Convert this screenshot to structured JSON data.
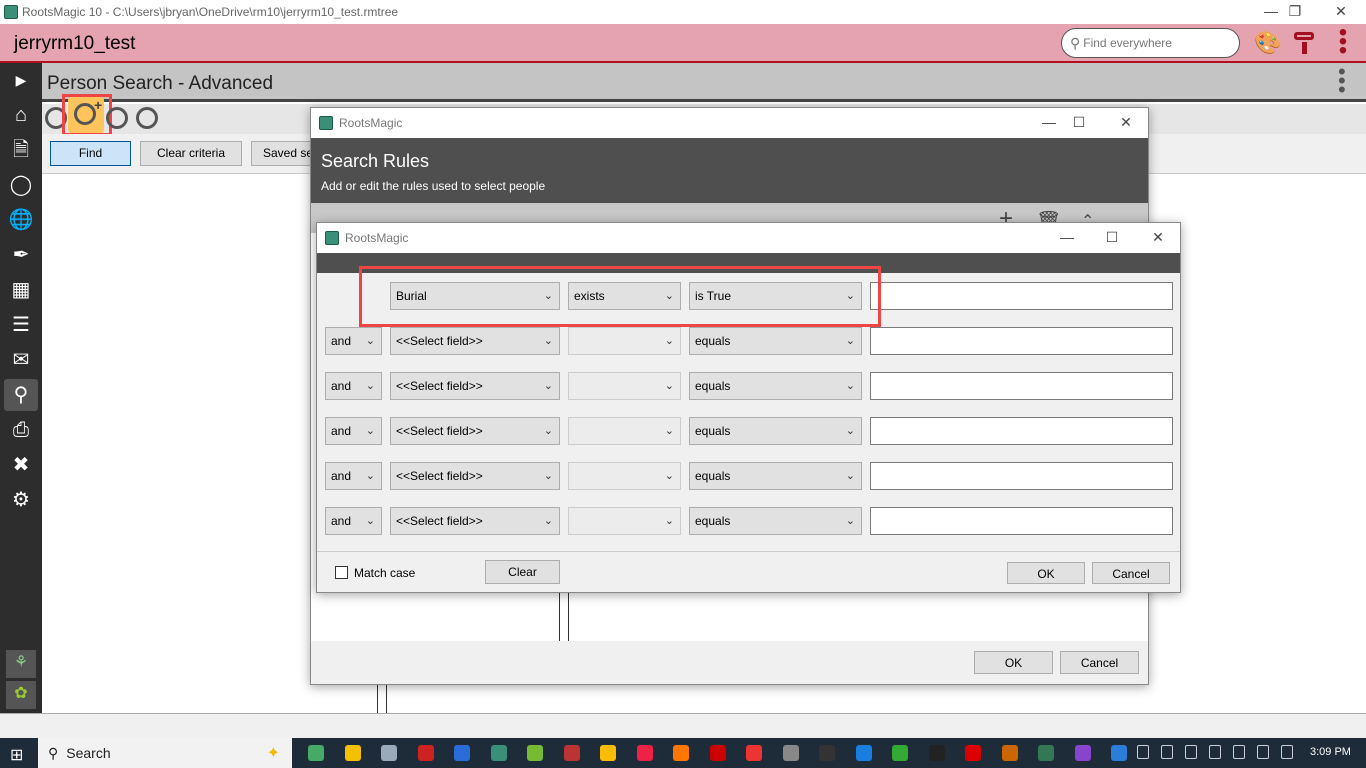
{
  "window": {
    "title": "RootsMagic 10 - C:\\Users\\jbryan\\OneDrive\\rm10\\jerryrm10_test.rmtree"
  },
  "header": {
    "database": "jerryrm10_test",
    "search_placeholder": "Find everywhere"
  },
  "page": {
    "title": "Person Search - Advanced",
    "buttons": {
      "find": "Find",
      "clear": "Clear criteria",
      "saved": "Saved se"
    }
  },
  "sidebar": {
    "items": [
      "expand",
      "home",
      "file",
      "people",
      "places",
      "sources",
      "media",
      "tasks",
      "mail",
      "search",
      "print",
      "tools",
      "settings"
    ]
  },
  "outer_dialog": {
    "app": "RootsMagic",
    "title": "Search Rules",
    "subtitle": "Add or edit the rules used to select people",
    "ok": "OK",
    "cancel": "Cancel"
  },
  "inner_dialog": {
    "app": "RootsMagic",
    "rows": [
      {
        "conj": "",
        "field": "Burial",
        "qualifier": "exists",
        "operator": "is True",
        "value": ""
      },
      {
        "conj": "and",
        "field": "<<Select field>>",
        "qualifier": "",
        "operator": "equals",
        "value": ""
      },
      {
        "conj": "and",
        "field": "<<Select field>>",
        "qualifier": "",
        "operator": "equals",
        "value": ""
      },
      {
        "conj": "and",
        "field": "<<Select field>>",
        "qualifier": "",
        "operator": "equals",
        "value": ""
      },
      {
        "conj": "and",
        "field": "<<Select field>>",
        "qualifier": "",
        "operator": "equals",
        "value": ""
      },
      {
        "conj": "and",
        "field": "<<Select field>>",
        "qualifier": "",
        "operator": "equals",
        "value": ""
      }
    ],
    "match_case": "Match case",
    "match_case_checked": false,
    "clear": "Clear",
    "ok": "OK",
    "cancel": "Cancel"
  },
  "taskbar": {
    "search": "Search",
    "time": "3:09 PM"
  },
  "colors": {
    "header": "#e5a3b0",
    "accent": "#a01020",
    "highlight": "#f04545"
  }
}
